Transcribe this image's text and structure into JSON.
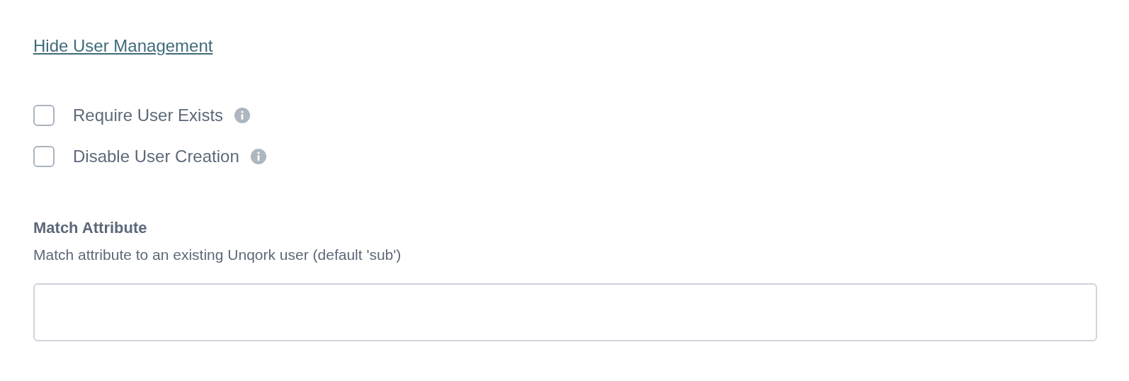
{
  "toggle_link": "Hide User Management",
  "options": [
    {
      "label": "Require User Exists",
      "checked": false
    },
    {
      "label": "Disable User Creation",
      "checked": false
    }
  ],
  "match_attribute": {
    "label": "Match Attribute",
    "description": "Match attribute to an existing Unqork user (default 'sub')"
  }
}
